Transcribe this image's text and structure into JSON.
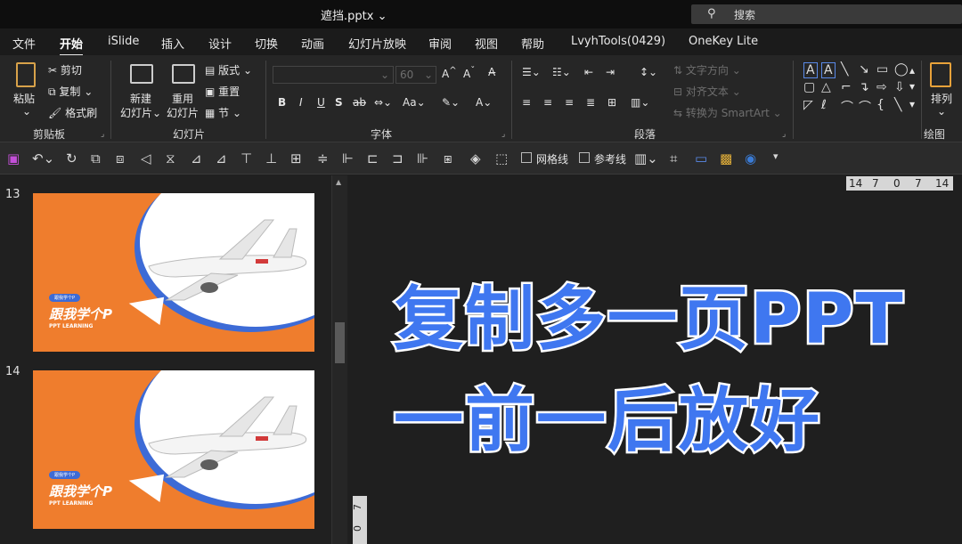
{
  "window": {
    "title": "遮挡.pptx",
    "title_caret": "⌄",
    "search_placeholder": "搜索"
  },
  "menu": {
    "tabs": [
      "文件",
      "开始",
      "iSlide",
      "插入",
      "设计",
      "切换",
      "动画",
      "幻灯片放映",
      "审阅",
      "视图",
      "帮助",
      "LvyhTools(0429)",
      "OneKey Lite"
    ],
    "active": "开始"
  },
  "ribbon": {
    "clipboard": {
      "paste": "粘贴",
      "cut": "剪切",
      "copy": "复制",
      "format_painter": "格式刷",
      "label": "剪贴板"
    },
    "slides": {
      "new_slide": "新建",
      "new_slide2": "幻灯片",
      "reuse": "重用",
      "reuse2": "幻灯片",
      "layout": "版式",
      "reset": "重置",
      "section": "节",
      "label": "幻灯片"
    },
    "font": {
      "size": "60",
      "label": "字体",
      "bold": "B",
      "italic": "I",
      "underline": "U",
      "shadow": "S",
      "strike": "ab",
      "case": "Aa"
    },
    "paragraph": {
      "text_direction": "文字方向",
      "align_text": "对齐文本",
      "smartart": "转换为 SmartArt",
      "label": "段落"
    },
    "drawing": {
      "arrange": "排列",
      "label": "绘图"
    }
  },
  "qat": {
    "gridlines": "网格线",
    "guides": "参考线"
  },
  "thumbnails": [
    {
      "number": "13",
      "badge": "跟我学个P",
      "headline": "跟我学个P",
      "sub": "PPT LEARNING"
    },
    {
      "number": "14",
      "badge": "跟我学个P",
      "headline": "跟我学个P",
      "sub": "PPT LEARNING"
    }
  ],
  "ruler_top": [
    "14",
    "7",
    "0",
    "7",
    "14"
  ],
  "ruler_left": [
    "0",
    "7"
  ],
  "overlay": {
    "line1": "复制多一页PPT",
    "line2": "一前一后放好"
  },
  "colors": {
    "accent_blue": "#3f77f0",
    "slide_orange": "#ef7d2d"
  }
}
